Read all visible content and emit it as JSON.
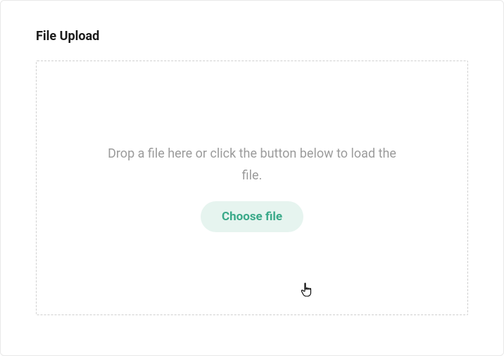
{
  "card": {
    "title": "File Upload"
  },
  "dropzone": {
    "hint": "Drop a file here or click the button below to load the file.",
    "button_label": "Choose file"
  }
}
